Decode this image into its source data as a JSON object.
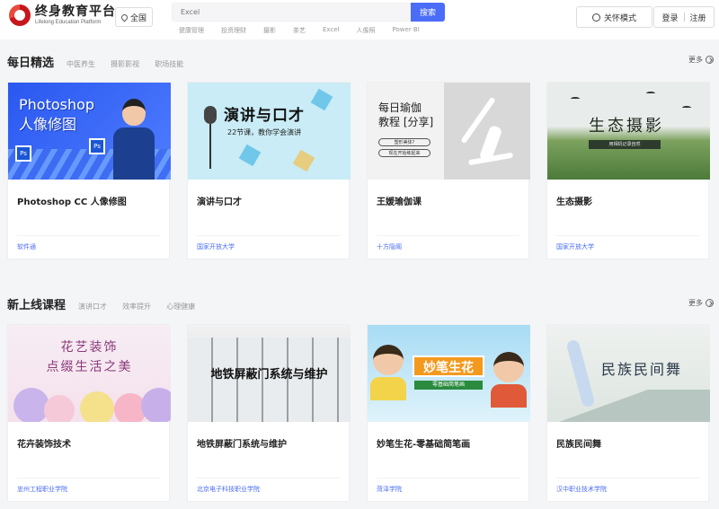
{
  "header": {
    "logo_cn": "终身教育平台",
    "logo_en": "Lifelong Education Platform",
    "region_label": "全国",
    "search": {
      "placeholder": "Excel",
      "button_label": "搜索"
    },
    "hot_words": [
      "健康管理",
      "投资理财",
      "摄影",
      "茶艺",
      "Excel",
      "人像照",
      "Power BI"
    ],
    "care_mode_label": "关怀模式",
    "login_label": "登录",
    "register_label": "注册"
  },
  "sections": [
    {
      "title": "每日精选",
      "tabs": [
        "中医养生",
        "摄影影视",
        "职场技能"
      ],
      "more_label": "更多",
      "cards": [
        {
          "title": "Photoshop CC 人像修图",
          "org": "软件通",
          "thumb_text": [
            "Photoshop",
            "人像修图"
          ],
          "thumb_icon": "Ps"
        },
        {
          "title": "演讲与口才",
          "org": "国家开放大学",
          "thumb_text": [
            "演讲与口才",
            "22节课，教你学会演讲"
          ]
        },
        {
          "title": "王媛瑜伽课",
          "org": "十方隐阁",
          "thumb_text": [
            "每日瑜伽",
            "教程 [分享]",
            "塑形美体?",
            "现在开始练起来"
          ]
        },
        {
          "title": "生态摄影",
          "org": "国家开放大学",
          "thumb_text": [
            "生态摄影",
            "用相机记录自然"
          ]
        }
      ]
    },
    {
      "title": "新上线课程",
      "tabs": [
        "演讲口才",
        "效率提升",
        "心理健康"
      ],
      "more_label": "更多",
      "cards": [
        {
          "title": "花卉装饰技术",
          "org": "忠州工程职业学院",
          "thumb_text": [
            "花艺装饰",
            "点缀生活之美"
          ]
        },
        {
          "title": "地铁屏蔽门系统与维护",
          "org": "北京电子科技职业学院",
          "thumb_text": [
            "地铁屏蔽门系统与维护"
          ]
        },
        {
          "title": "妙笔生花-零基础简笔画",
          "org": "菏泽学院",
          "thumb_text": [
            "妙笔生花",
            "零基础简笔画"
          ]
        },
        {
          "title": "民族民间舞",
          "org": "汉中职业技术学院",
          "thumb_text": [
            "民族民间舞"
          ]
        }
      ]
    }
  ],
  "colors": {
    "accent": "#4a6cf7",
    "brand_red": "#c8161d"
  }
}
